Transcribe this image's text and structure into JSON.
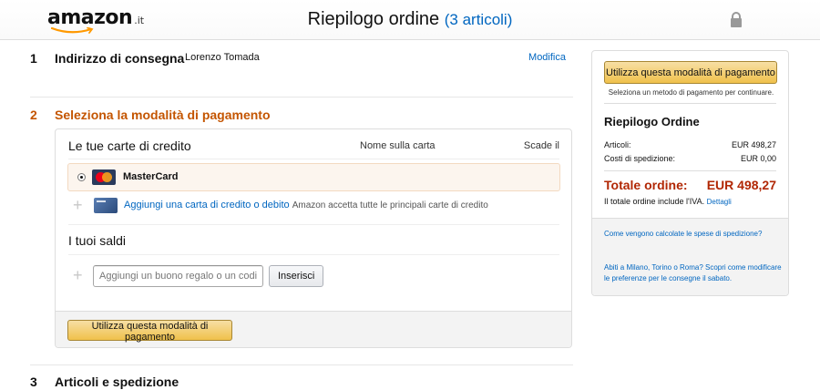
{
  "header": {
    "logo_text": "amazon",
    "logo_tld": ".it",
    "title": "Riepilogo ordine",
    "items_count": "(3 articoli)"
  },
  "step1": {
    "number": "1",
    "title": "Indirizzo di consegna",
    "address_name": "Lorenzo Tomada",
    "modify_label": "Modifica"
  },
  "step2": {
    "number": "2",
    "title": "Seleziona la modalità di pagamento",
    "cards_header": "Le tue carte di credito",
    "col_name": "Nome sulla carta",
    "col_expiry": "Scade il",
    "selected_card": "MasterCard",
    "add_card_link": "Aggiungi una carta di credito o debito",
    "add_card_note": "Amazon accetta tutte le principali carte di credito",
    "balances_header": "I tuoi saldi",
    "gift_placeholder": "Aggiungi un buono regalo o un codice promozionale",
    "apply_button": "Inserisci",
    "use_method_button": "Utilizza questa modalità di pagamento"
  },
  "step3": {
    "number": "3",
    "title": "Articoli e spedizione"
  },
  "summary": {
    "use_method_button": "Utilizza questa modalità di pagamento",
    "select_note": "Seleziona un metodo di pagamento per continuare.",
    "title": "Riepilogo Ordine",
    "rows": [
      {
        "label": "Articoli:",
        "value": "EUR 498,27"
      },
      {
        "label": "Costi di spedizione:",
        "value": "EUR 0,00"
      }
    ],
    "total_label": "Totale ordine:",
    "total_value": "EUR 498,27",
    "vat_note": "Il totale ordine include l'IVA.",
    "details_link": "Dettagli",
    "shipping_link": "Come vengono calcolate le spese di spedizione?",
    "saturday_link": "Abiti a Milano, Torino o Roma? Scopri come modificare le preferenze per le consegne il sabato."
  },
  "colors": {
    "accent_orange": "#c45500",
    "link_blue": "#0066c0",
    "price_red": "#b12704",
    "button_yellow": "#f0c14b"
  }
}
